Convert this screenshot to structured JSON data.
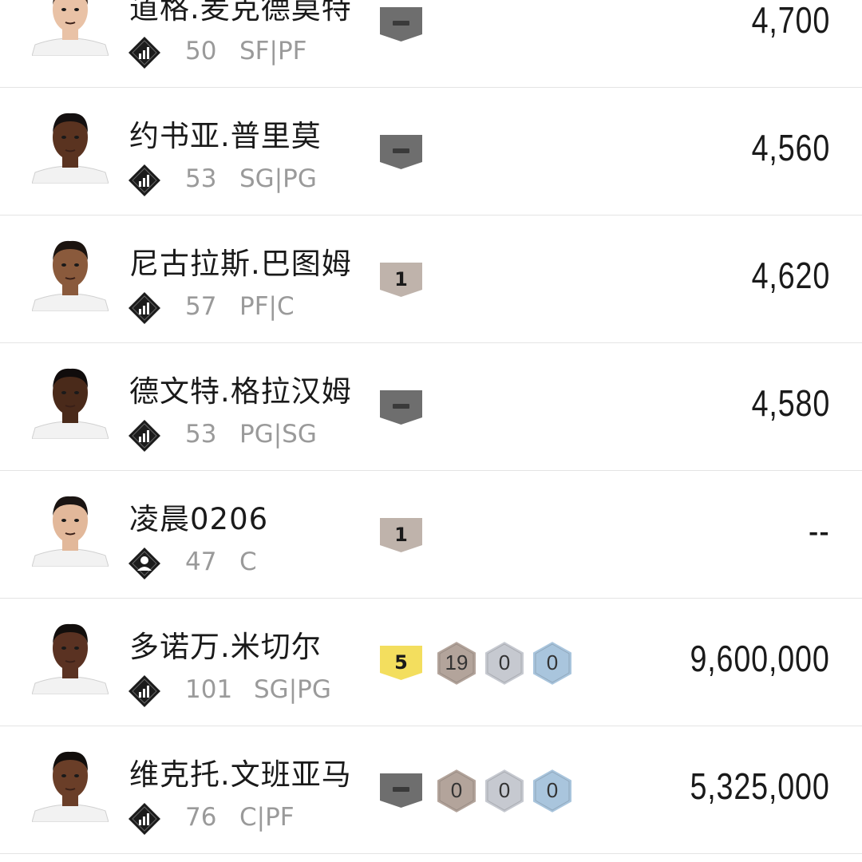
{
  "colors": {
    "badge_dash": "#6e6e6e",
    "badge_rank": "#bfb3ab",
    "badge_rank_gold": "#f3de5e",
    "hex_bronze": "#b3a49b",
    "hex_silver": "#c6c9d0",
    "hex_blue": "#a9c5dd"
  },
  "players": [
    {
      "name": "道格.麦克德莫特",
      "rating": "50",
      "position": "SF|PF",
      "type_icon": "stats-icon",
      "badge": "—",
      "badge_type": "dash",
      "counts": [],
      "price": "4,700",
      "skin": "#e9c2a6",
      "hair": "#3b2a20"
    },
    {
      "name": "约书亚.普里莫",
      "rating": "53",
      "position": "SG|PG",
      "type_icon": "stats-icon",
      "badge": "—",
      "badge_type": "dash",
      "counts": [],
      "price": "4,560",
      "skin": "#5a3320",
      "hair": "#141010"
    },
    {
      "name": "尼古拉斯.巴图姆",
      "rating": "57",
      "position": "PF|C",
      "type_icon": "stats-icon",
      "badge": "1",
      "badge_type": "rank",
      "counts": [],
      "price": "4,620",
      "skin": "#8a5a3c",
      "hair": "#1c1410"
    },
    {
      "name": "德文特.格拉汉姆",
      "rating": "53",
      "position": "PG|SG",
      "type_icon": "stats-icon",
      "badge": "—",
      "badge_type": "dash",
      "counts": [],
      "price": "4,580",
      "skin": "#4a2a1a",
      "hair": "#100c0c"
    },
    {
      "name": "凌晨0206",
      "rating": "47",
      "position": "C",
      "type_icon": "person-icon",
      "badge": "1",
      "badge_type": "rank",
      "counts": [],
      "price": "--",
      "skin": "#e2b89a",
      "hair": "#1a1412"
    },
    {
      "name": "多诺万.米切尔",
      "rating": "101",
      "position": "SG|PG",
      "type_icon": "stats-icon",
      "badge": "5",
      "badge_type": "gold",
      "counts": [
        "19",
        "0",
        "0"
      ],
      "price": "9,600,000",
      "skin": "#5a3222",
      "hair": "#120e0c"
    },
    {
      "name": "维克托.文班亚马",
      "rating": "76",
      "position": "C|PF",
      "type_icon": "stats-icon",
      "badge": "—",
      "badge_type": "dash",
      "counts": [
        "0",
        "0",
        "0"
      ],
      "price": "5,325,000",
      "skin": "#6a3e28",
      "hair": "#120e0c"
    }
  ]
}
